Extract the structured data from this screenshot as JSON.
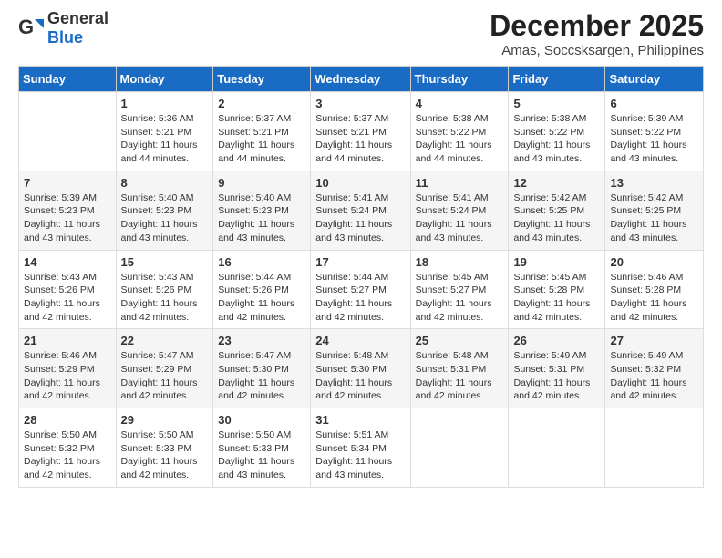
{
  "header": {
    "logo_general": "General",
    "logo_blue": "Blue",
    "month_year": "December 2025",
    "location": "Amas, Soccsksargen, Philippines"
  },
  "calendar": {
    "days_of_week": [
      "Sunday",
      "Monday",
      "Tuesday",
      "Wednesday",
      "Thursday",
      "Friday",
      "Saturday"
    ],
    "weeks": [
      [
        {
          "day": "",
          "info": ""
        },
        {
          "day": "1",
          "info": "Sunrise: 5:36 AM\nSunset: 5:21 PM\nDaylight: 11 hours\nand 44 minutes."
        },
        {
          "day": "2",
          "info": "Sunrise: 5:37 AM\nSunset: 5:21 PM\nDaylight: 11 hours\nand 44 minutes."
        },
        {
          "day": "3",
          "info": "Sunrise: 5:37 AM\nSunset: 5:21 PM\nDaylight: 11 hours\nand 44 minutes."
        },
        {
          "day": "4",
          "info": "Sunrise: 5:38 AM\nSunset: 5:22 PM\nDaylight: 11 hours\nand 44 minutes."
        },
        {
          "day": "5",
          "info": "Sunrise: 5:38 AM\nSunset: 5:22 PM\nDaylight: 11 hours\nand 43 minutes."
        },
        {
          "day": "6",
          "info": "Sunrise: 5:39 AM\nSunset: 5:22 PM\nDaylight: 11 hours\nand 43 minutes."
        }
      ],
      [
        {
          "day": "7",
          "info": "Sunrise: 5:39 AM\nSunset: 5:23 PM\nDaylight: 11 hours\nand 43 minutes."
        },
        {
          "day": "8",
          "info": "Sunrise: 5:40 AM\nSunset: 5:23 PM\nDaylight: 11 hours\nand 43 minutes."
        },
        {
          "day": "9",
          "info": "Sunrise: 5:40 AM\nSunset: 5:23 PM\nDaylight: 11 hours\nand 43 minutes."
        },
        {
          "day": "10",
          "info": "Sunrise: 5:41 AM\nSunset: 5:24 PM\nDaylight: 11 hours\nand 43 minutes."
        },
        {
          "day": "11",
          "info": "Sunrise: 5:41 AM\nSunset: 5:24 PM\nDaylight: 11 hours\nand 43 minutes."
        },
        {
          "day": "12",
          "info": "Sunrise: 5:42 AM\nSunset: 5:25 PM\nDaylight: 11 hours\nand 43 minutes."
        },
        {
          "day": "13",
          "info": "Sunrise: 5:42 AM\nSunset: 5:25 PM\nDaylight: 11 hours\nand 43 minutes."
        }
      ],
      [
        {
          "day": "14",
          "info": "Sunrise: 5:43 AM\nSunset: 5:26 PM\nDaylight: 11 hours\nand 42 minutes."
        },
        {
          "day": "15",
          "info": "Sunrise: 5:43 AM\nSunset: 5:26 PM\nDaylight: 11 hours\nand 42 minutes."
        },
        {
          "day": "16",
          "info": "Sunrise: 5:44 AM\nSunset: 5:26 PM\nDaylight: 11 hours\nand 42 minutes."
        },
        {
          "day": "17",
          "info": "Sunrise: 5:44 AM\nSunset: 5:27 PM\nDaylight: 11 hours\nand 42 minutes."
        },
        {
          "day": "18",
          "info": "Sunrise: 5:45 AM\nSunset: 5:27 PM\nDaylight: 11 hours\nand 42 minutes."
        },
        {
          "day": "19",
          "info": "Sunrise: 5:45 AM\nSunset: 5:28 PM\nDaylight: 11 hours\nand 42 minutes."
        },
        {
          "day": "20",
          "info": "Sunrise: 5:46 AM\nSunset: 5:28 PM\nDaylight: 11 hours\nand 42 minutes."
        }
      ],
      [
        {
          "day": "21",
          "info": "Sunrise: 5:46 AM\nSunset: 5:29 PM\nDaylight: 11 hours\nand 42 minutes."
        },
        {
          "day": "22",
          "info": "Sunrise: 5:47 AM\nSunset: 5:29 PM\nDaylight: 11 hours\nand 42 minutes."
        },
        {
          "day": "23",
          "info": "Sunrise: 5:47 AM\nSunset: 5:30 PM\nDaylight: 11 hours\nand 42 minutes."
        },
        {
          "day": "24",
          "info": "Sunrise: 5:48 AM\nSunset: 5:30 PM\nDaylight: 11 hours\nand 42 minutes."
        },
        {
          "day": "25",
          "info": "Sunrise: 5:48 AM\nSunset: 5:31 PM\nDaylight: 11 hours\nand 42 minutes."
        },
        {
          "day": "26",
          "info": "Sunrise: 5:49 AM\nSunset: 5:31 PM\nDaylight: 11 hours\nand 42 minutes."
        },
        {
          "day": "27",
          "info": "Sunrise: 5:49 AM\nSunset: 5:32 PM\nDaylight: 11 hours\nand 42 minutes."
        }
      ],
      [
        {
          "day": "28",
          "info": "Sunrise: 5:50 AM\nSunset: 5:32 PM\nDaylight: 11 hours\nand 42 minutes."
        },
        {
          "day": "29",
          "info": "Sunrise: 5:50 AM\nSunset: 5:33 PM\nDaylight: 11 hours\nand 42 minutes."
        },
        {
          "day": "30",
          "info": "Sunrise: 5:50 AM\nSunset: 5:33 PM\nDaylight: 11 hours\nand 43 minutes."
        },
        {
          "day": "31",
          "info": "Sunrise: 5:51 AM\nSunset: 5:34 PM\nDaylight: 11 hours\nand 43 minutes."
        },
        {
          "day": "",
          "info": ""
        },
        {
          "day": "",
          "info": ""
        },
        {
          "day": "",
          "info": ""
        }
      ]
    ]
  }
}
